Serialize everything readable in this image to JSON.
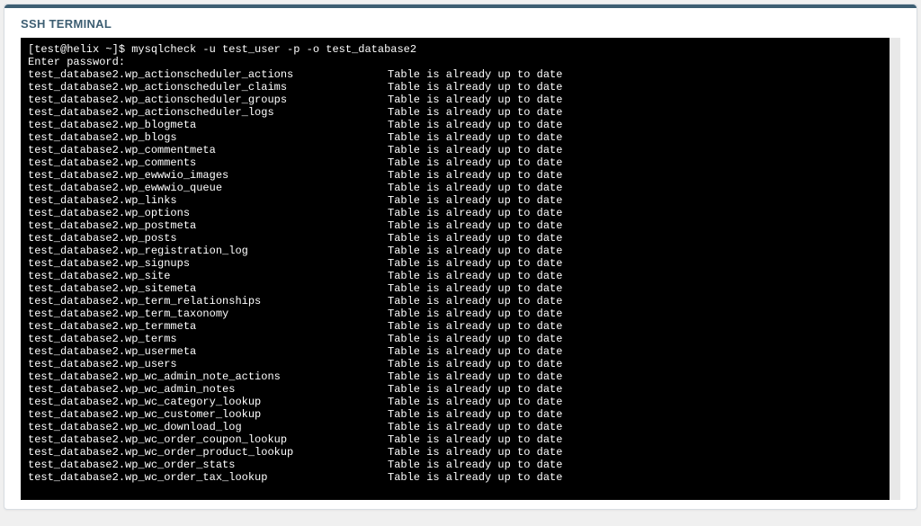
{
  "panel": {
    "title": "SSH TERMINAL"
  },
  "terminal": {
    "prompt": "[test@helix ~]$ ",
    "command": "mysqlcheck -u test_user -p -o test_database2",
    "password_prompt": "Enter password:",
    "status_text": "Table is already up to date",
    "tables": [
      "test_database2.wp_actionscheduler_actions",
      "test_database2.wp_actionscheduler_claims",
      "test_database2.wp_actionscheduler_groups",
      "test_database2.wp_actionscheduler_logs",
      "test_database2.wp_blogmeta",
      "test_database2.wp_blogs",
      "test_database2.wp_commentmeta",
      "test_database2.wp_comments",
      "test_database2.wp_ewwwio_images",
      "test_database2.wp_ewwwio_queue",
      "test_database2.wp_links",
      "test_database2.wp_options",
      "test_database2.wp_postmeta",
      "test_database2.wp_posts",
      "test_database2.wp_registration_log",
      "test_database2.wp_signups",
      "test_database2.wp_site",
      "test_database2.wp_sitemeta",
      "test_database2.wp_term_relationships",
      "test_database2.wp_term_taxonomy",
      "test_database2.wp_termmeta",
      "test_database2.wp_terms",
      "test_database2.wp_usermeta",
      "test_database2.wp_users",
      "test_database2.wp_wc_admin_note_actions",
      "test_database2.wp_wc_admin_notes",
      "test_database2.wp_wc_category_lookup",
      "test_database2.wp_wc_customer_lookup",
      "test_database2.wp_wc_download_log",
      "test_database2.wp_wc_order_coupon_lookup",
      "test_database2.wp_wc_order_product_lookup",
      "test_database2.wp_wc_order_stats",
      "test_database2.wp_wc_order_tax_lookup"
    ]
  }
}
